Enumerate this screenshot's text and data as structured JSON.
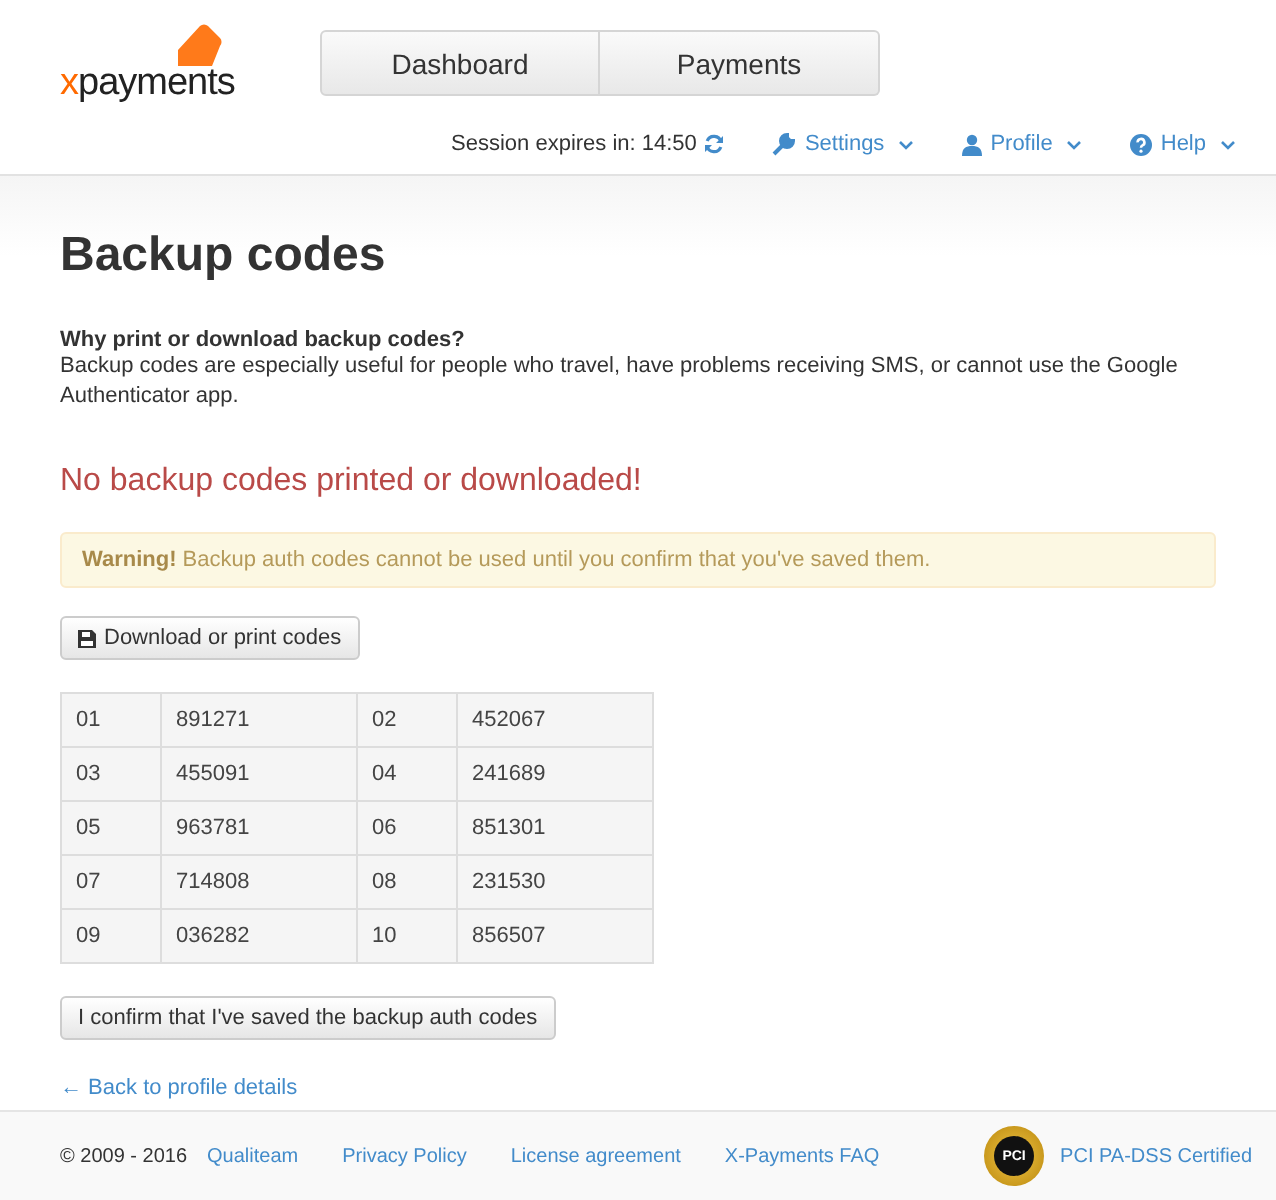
{
  "logo": {
    "accent": "x",
    "name": "payments"
  },
  "nav_tabs": [
    {
      "label": "Dashboard"
    },
    {
      "label": "Payments"
    }
  ],
  "session": {
    "label": "Session expires in: 14:50"
  },
  "menus": [
    {
      "kind": "settings",
      "label": "Settings"
    },
    {
      "kind": "profile",
      "label": "Profile"
    },
    {
      "kind": "help",
      "label": "Help"
    }
  ],
  "page_title": "Backup codes",
  "intro": {
    "heading": "Why print or download backup codes?",
    "text": "Backup codes are especially useful for people who travel, have problems receiving SMS, or cannot use the Google Authenticator app."
  },
  "status_message": "No backup codes printed or downloaded!",
  "warning": "**Warning!** Backup auth codes cannot be used until you confirm that you've saved them.",
  "download_button": "Download or print codes",
  "codes": [
    {
      "index": "01",
      "code": "891271"
    },
    {
      "index": "02",
      "code": "452067"
    },
    {
      "index": "03",
      "code": "455091"
    },
    {
      "index": "04",
      "code": "241689"
    },
    {
      "index": "05",
      "code": "963781"
    },
    {
      "index": "06",
      "code": "851301"
    },
    {
      "index": "07",
      "code": "714808"
    },
    {
      "index": "08",
      "code": "231530"
    },
    {
      "index": "09",
      "code": "036282"
    },
    {
      "index": "10",
      "code": "856507"
    }
  ],
  "confirm_button": "I confirm that I've saved the backup auth codes",
  "back_link": "← Back to profile details",
  "footer": {
    "copyright": "© 2009 - 2016",
    "links": [
      "Qualiteam",
      "Privacy Policy",
      "License agreement",
      "X-Payments FAQ"
    ],
    "badge_text": "PCI",
    "certified": "PCI PA-DSS Certified"
  }
}
